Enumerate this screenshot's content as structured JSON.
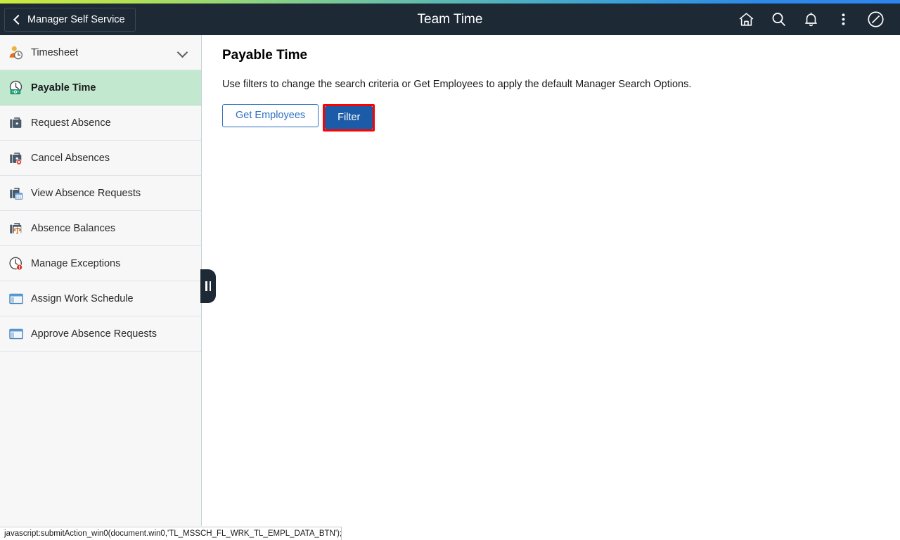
{
  "header": {
    "back_label": "Manager Self Service",
    "title": "Team Time",
    "icons": [
      {
        "name": "home-icon",
        "label": "Home"
      },
      {
        "name": "search-icon",
        "label": "Search"
      },
      {
        "name": "notifications-bell-icon",
        "label": "Notifications"
      },
      {
        "name": "actions-kebab-menu-icon",
        "label": "Actions"
      },
      {
        "name": "navigator-compass-icon",
        "label": "NavBar"
      }
    ]
  },
  "sidebar": {
    "items": [
      {
        "label": "Timesheet",
        "icon": "person-clock-icon",
        "selected": false,
        "expandable": true
      },
      {
        "label": "Payable Time",
        "icon": "clock-money-icon",
        "selected": true,
        "expandable": false
      },
      {
        "label": "Request Absence",
        "icon": "briefcase-icon",
        "selected": false,
        "expandable": false
      },
      {
        "label": "Cancel Absences",
        "icon": "briefcase-cancel-icon",
        "selected": false,
        "expandable": false
      },
      {
        "label": "View Absence Requests",
        "icon": "briefcase-calendar-icon",
        "selected": false,
        "expandable": false
      },
      {
        "label": "Absence Balances",
        "icon": "briefcase-balance-icon",
        "selected": false,
        "expandable": false
      },
      {
        "label": "Manage Exceptions",
        "icon": "clock-alert-icon",
        "selected": false,
        "expandable": false
      },
      {
        "label": "Assign Work Schedule",
        "icon": "window-panel-icon",
        "selected": false,
        "expandable": false
      },
      {
        "label": "Approve Absence Requests",
        "icon": "window-panel-icon",
        "selected": false,
        "expandable": false
      }
    ]
  },
  "main": {
    "page_title": "Payable Time",
    "instructions": "Use filters to change the search criteria or Get Employees to apply the default Manager Search Options.",
    "get_employees_label": "Get Employees",
    "filter_label": "Filter"
  },
  "status_bar": {
    "text": "javascript:submitAction_win0(document.win0,'TL_MSSCH_FL_WRK_TL_EMPL_DATA_BTN');"
  },
  "colors": {
    "header_bg": "#1e2936",
    "selected_row": "#c2e8d0",
    "primary_button": "#1c5ba8",
    "highlight_border": "#ff0000",
    "link_blue": "#2f6fc0"
  }
}
